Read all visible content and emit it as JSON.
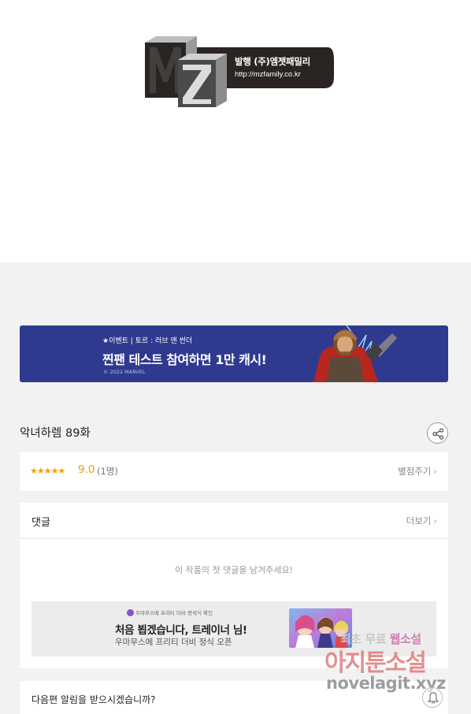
{
  "publisher": {
    "logo_text": "MZ",
    "name": "발행 (주)엠젯패밀리",
    "url": "http://mzfamily.co.kr"
  },
  "event_banner": {
    "tag": "★이벤트 | 토르 : 러브 앤 썬더",
    "headline": "찐팬 테스트 참여하면 1만 캐시!",
    "copyright": "© 2022 MARVEL",
    "background_color": "#2f3a8f"
  },
  "episode": {
    "title": "악녀하렘 89화",
    "share_icon": "share-icon"
  },
  "rating": {
    "stars": "★★★★★",
    "score": "9.0",
    "count": "(1명)",
    "rate_label": "별점주기",
    "rate_chevron": "›",
    "star_color": "#f2a10b"
  },
  "comments": {
    "title": "댓글",
    "more_label": "더보기",
    "more_chevron": "›",
    "empty_message": "이 작품의 첫 댓글을 남겨주세요!"
  },
  "ad": {
    "sub": "우마무스메 프리티 더비 병색식 확인",
    "title": "처음 뵙겠습니다, 트레이너 님!",
    "desc": "우마무스메 프리티 더비 정식 오픈"
  },
  "notify": {
    "text": "다음편 알림을 받으시겠습니까?"
  },
  "watermark": {
    "line1_a": "최초 무료",
    "line1_b": "웹소설",
    "line2": "아지툰소설",
    "line3": "novelagit.xyz"
  }
}
